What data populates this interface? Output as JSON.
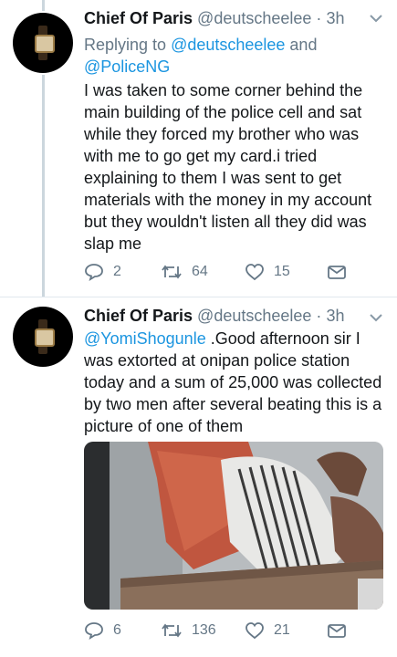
{
  "tweets": [
    {
      "name": "Chief Of Paris",
      "handle": "@deutscheelee",
      "dot": "·",
      "time": "3h",
      "replying_prefix": "Replying to ",
      "replying_to_1": "@deutscheelee",
      "replying_and": " and",
      "replying_to_2": "@PoliceNG",
      "text": "I was taken to some corner behind the main building of the police cell and sat while they forced my brother who was with me to go get my card.i tried explaining to them I was sent to get materials with the money in my account but they wouldn't listen all they did was slap me",
      "replies": "2",
      "retweets": "64",
      "likes": "15"
    },
    {
      "name": "Chief Of Paris",
      "handle": "@deutscheelee",
      "dot": "·",
      "time": "3h",
      "mention": "@YomiShogunle",
      "text": " .Good afternoon sir I was extorted at onipan police station today and a sum of 25,000 was collected by two men after several beating this is a picture of one of them",
      "replies": "6",
      "retweets": "136",
      "likes": "21"
    }
  ],
  "colors": {
    "link": "#1b95e0",
    "secondary": "#657786",
    "thread": "#ccd6dd"
  },
  "icons": [
    "reply-icon",
    "retweet-icon",
    "like-icon",
    "share-icon",
    "chevron-down-icon"
  ]
}
